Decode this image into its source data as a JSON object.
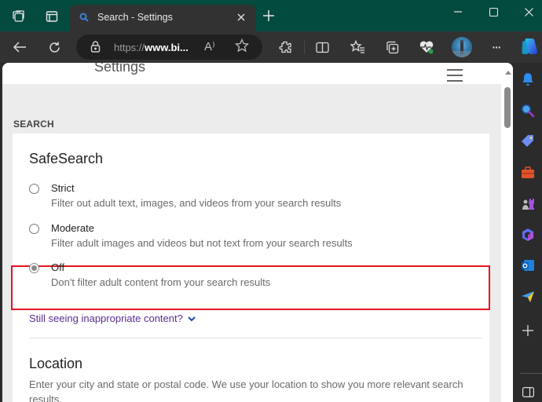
{
  "window": {
    "tab_title": "Search - Settings",
    "tab_favicon": "search-icon",
    "controls": [
      "minimize-icon",
      "maximize-icon",
      "close-icon"
    ]
  },
  "toolbar": {
    "url_prefix": "https://",
    "url_host": "www.bi...",
    "icons": [
      "back-icon",
      "refresh-icon",
      "lock-icon",
      "read-aloud-icon",
      "favorite-star-icon",
      "extensions-icon",
      "split-screen-icon",
      "favorites-icon",
      "collections-icon",
      "browser-essentials-icon",
      "profile-avatar",
      "more-icon",
      "copilot-icon"
    ],
    "read_aloud_glyph": "A⁾",
    "more_glyph": "···"
  },
  "page": {
    "title": "Settings",
    "section_label": "SEARCH",
    "safesearch": {
      "heading": "SafeSearch",
      "selected": "Off",
      "options": [
        {
          "label": "Strict",
          "description": "Filter out adult text, images, and videos from your search results",
          "checked": false
        },
        {
          "label": "Moderate",
          "description": "Filter adult images and videos but not text from your search results",
          "checked": false
        },
        {
          "label": "Off",
          "description": "Don't filter adult content from your search results",
          "checked": true
        }
      ],
      "link": "Still seeing inappropriate content?"
    },
    "location": {
      "heading": "Location",
      "description": "Enter your city and state or postal code. We use your location to show you more relevant search results."
    }
  },
  "sidebar": {
    "items": [
      "notifications-icon",
      "search-icon",
      "shopping-icon",
      "tools-icon",
      "games-icon",
      "microsoft365-icon",
      "outlook-icon",
      "drop-icon",
      "add-icon",
      "hide-sidebar-icon"
    ]
  },
  "colors": {
    "titlebar": "#044b3f",
    "highlight_border": "#e2171e",
    "link": "#5b2d91"
  }
}
